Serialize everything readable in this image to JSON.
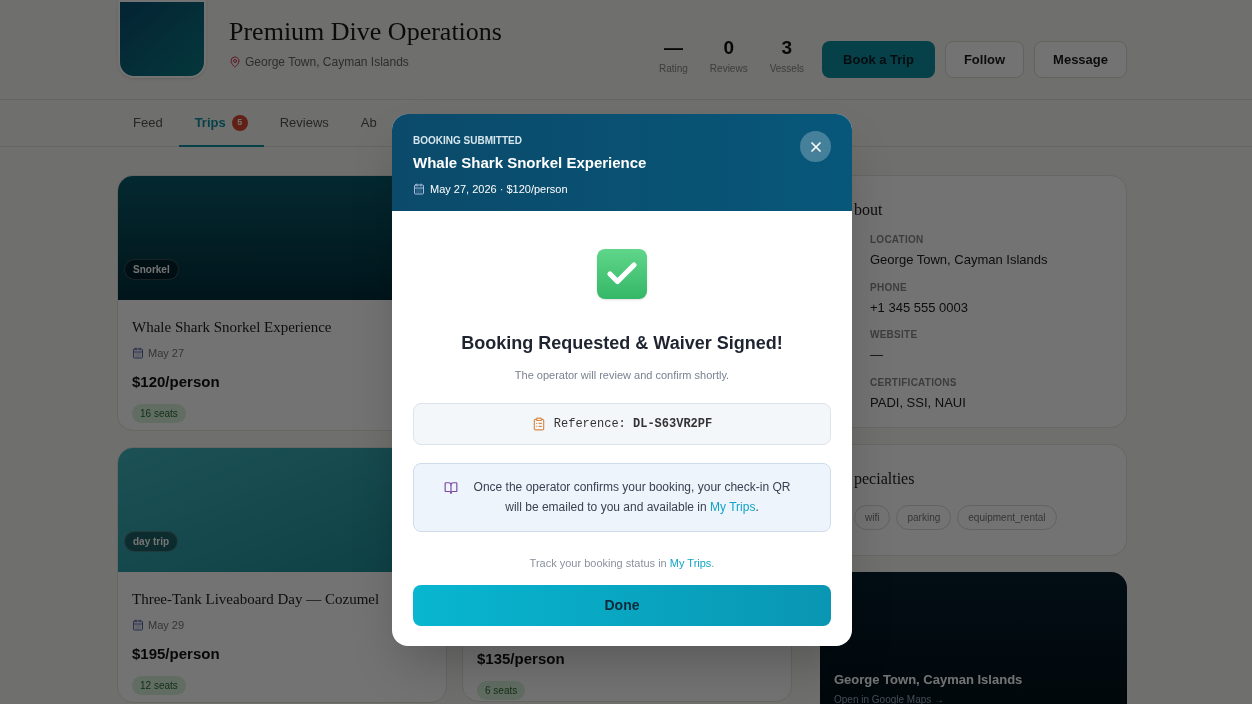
{
  "header": {
    "name": "Premium Dive Operations",
    "location": "George Town, Cayman Islands",
    "stats": [
      {
        "value": "—",
        "label": "Rating"
      },
      {
        "value": "0",
        "label": "Reviews"
      },
      {
        "value": "3",
        "label": "Vessels"
      }
    ],
    "buttons": [
      {
        "label": "Book a Trip",
        "kind": "primary"
      },
      {
        "label": "Follow",
        "kind": "outline"
      },
      {
        "label": "Message",
        "kind": "outline"
      }
    ]
  },
  "tabs": [
    {
      "label": "Feed",
      "selected": false
    },
    {
      "label": "Trips",
      "selected": true,
      "badge": "5"
    },
    {
      "label": "Reviews",
      "selected": false
    },
    {
      "label": "Ab",
      "selected": false
    }
  ],
  "trips": [
    {
      "tag": "Snorkel",
      "kind": "deep",
      "title": "Whale Shark Snorkel Experience",
      "date": "May 27",
      "price": "$120/person",
      "seats": "16 seats"
    },
    {
      "tag": "day trip",
      "kind": "shallow",
      "title": "Three-Tank Liveaboard Day — Cozumel",
      "date": "May 29",
      "price": "$195/person",
      "seats": "12 seats"
    }
  ],
  "trips_partial": [
    {
      "price": "$135/person",
      "seats": "6 seats"
    }
  ],
  "about": {
    "heading": "bout",
    "items": [
      {
        "label": "LOCATION",
        "value": "George Town, Cayman Islands"
      },
      {
        "label": "PHONE",
        "value": "+1 345 555 0003"
      },
      {
        "label": "WEBSITE",
        "value": "—"
      },
      {
        "label": "CERTIFICATIONS",
        "value": "PADI, SSI, NAUI"
      }
    ]
  },
  "specialties": {
    "heading": "pecialties",
    "tags": [
      "wifi",
      "parking",
      "equipment_rental"
    ]
  },
  "map": {
    "title": "George Town, Cayman Islands",
    "link": "Open in Google Maps →"
  },
  "modal": {
    "eyebrow": "BOOKING SUBMITTED",
    "title": "Whale Shark Snorkel Experience",
    "meta": "May 27, 2026 · $120/person",
    "heading": "Booking Requested & Waiver Signed!",
    "subtitle": "The operator will review and confirm shortly.",
    "reference": "Reference: **DL-S63VR2PF**",
    "info": {
      "before": "Once the operator confirms your booking, your check-in QR will be emailed to you and available in ",
      "link": "My Trips",
      "after": "."
    },
    "track": {
      "before": "Track your booking status in ",
      "link": "My Trips",
      "after": "."
    },
    "done": "Done"
  }
}
